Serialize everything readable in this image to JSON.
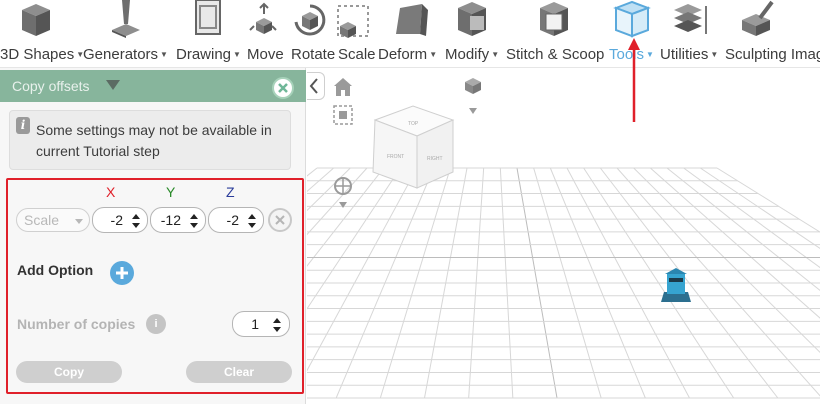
{
  "toolbar": {
    "items": [
      {
        "label": "3D Shapes",
        "icon": "cube-shapes-icon",
        "has_dropdown": true
      },
      {
        "label": "Generators",
        "icon": "generator-icon",
        "has_dropdown": true
      },
      {
        "label": "Drawing",
        "icon": "drawing-icon",
        "has_dropdown": true
      },
      {
        "label": "Move",
        "icon": "move-icon",
        "has_dropdown": false
      },
      {
        "label": "Rotate",
        "icon": "rotate-icon",
        "has_dropdown": false
      },
      {
        "label": "Scale",
        "icon": "scale-icon",
        "has_dropdown": false
      },
      {
        "label": "Deform",
        "icon": "deform-icon",
        "has_dropdown": true
      },
      {
        "label": "Modify",
        "icon": "modify-icon",
        "has_dropdown": true
      },
      {
        "label": "Stitch & Scoop",
        "icon": "stitch-scoop-icon",
        "has_dropdown": false
      },
      {
        "label": "Tools",
        "icon": "tools-icon",
        "has_dropdown": true,
        "active": true
      },
      {
        "label": "Utilities",
        "icon": "utilities-icon",
        "has_dropdown": true
      },
      {
        "label": "Sculpting Imag",
        "icon": "sculpting-icon",
        "has_dropdown": false
      }
    ],
    "active_color": "#5aa9dc"
  },
  "panel": {
    "title": "Copy offsets",
    "header_color": "#87b59c",
    "notice_text": "Some settings may not be available in current Tutorial step",
    "axes": {
      "x": "X",
      "y": "Y",
      "z": "Z"
    },
    "mode_select": "Scale",
    "offsets": {
      "x": "-2",
      "y": "-12",
      "z": "-2"
    },
    "add_option_label": "Add Option",
    "copies_label": "Number of copies",
    "copies_info": "i",
    "copies_value": "1",
    "copy_button": "Copy",
    "clear_button": "Clear",
    "highlight_color": "#e0202a"
  },
  "viewport": {
    "view_cube_faces": [
      "TOP",
      "FRONT",
      "RIGHT"
    ]
  }
}
